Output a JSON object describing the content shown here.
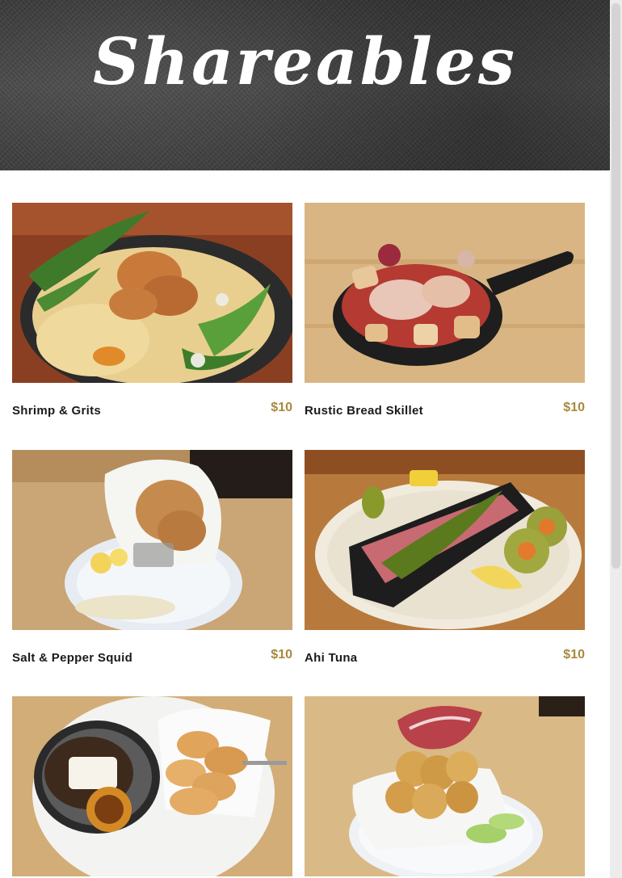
{
  "header": {
    "title": "Shareables"
  },
  "menu": {
    "items": [
      {
        "name": "Shrimp & Grits",
        "price": "$10"
      },
      {
        "name": "Rustic Bread Skillet",
        "price": "$10"
      },
      {
        "name": "Salt & Pepper Squid",
        "price": "$10"
      },
      {
        "name": "Ahi Tuna",
        "price": "$10"
      },
      {
        "name": "",
        "price": ""
      },
      {
        "name": "",
        "price": ""
      }
    ]
  },
  "colors": {
    "price": "#a88a3c",
    "header_bg": "#3d3d3d",
    "text": "#1a1a1a"
  }
}
